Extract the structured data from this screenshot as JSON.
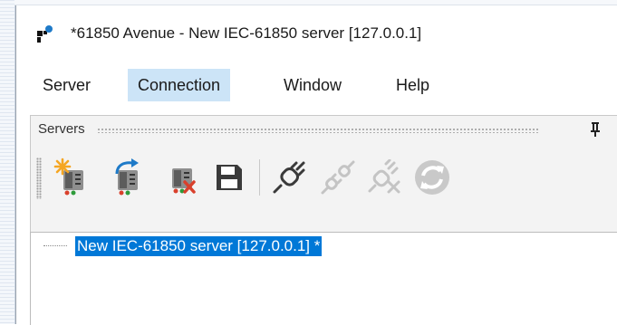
{
  "window": {
    "title": "*61850 Avenue - New IEC-61850 server [127.0.0.1]"
  },
  "menu": {
    "items": [
      {
        "label": "Server",
        "active": false
      },
      {
        "label": "Connection",
        "active": true
      },
      {
        "label": "Window",
        "active": false
      },
      {
        "label": "Help",
        "active": false
      }
    ]
  },
  "servers_panel": {
    "title": "Servers",
    "pin_icon": "pin-icon"
  },
  "toolbar": {
    "buttons": [
      {
        "icon": "new-server-icon",
        "enabled": true
      },
      {
        "icon": "open-server-icon",
        "enabled": true
      },
      {
        "icon": "delete-server-icon",
        "enabled": true
      },
      {
        "icon": "save-icon",
        "enabled": true
      },
      {
        "icon": "connect-icon",
        "enabled": true
      },
      {
        "icon": "disconnect-icon",
        "enabled": false
      },
      {
        "icon": "disconnect-all-icon",
        "enabled": false
      },
      {
        "icon": "refresh-icon",
        "enabled": false
      }
    ]
  },
  "tree": {
    "nodes": [
      {
        "label": "New IEC-61850 server [127.0.0.1] *",
        "selected": true
      }
    ]
  },
  "colors": {
    "selection": "#0078d7",
    "menu_active": "#cce4f7",
    "panel_bg": "#f3f3f3",
    "star_orange": "#f5a623",
    "arrow_blue": "#1e7ac8",
    "delete_red": "#d9402c"
  }
}
